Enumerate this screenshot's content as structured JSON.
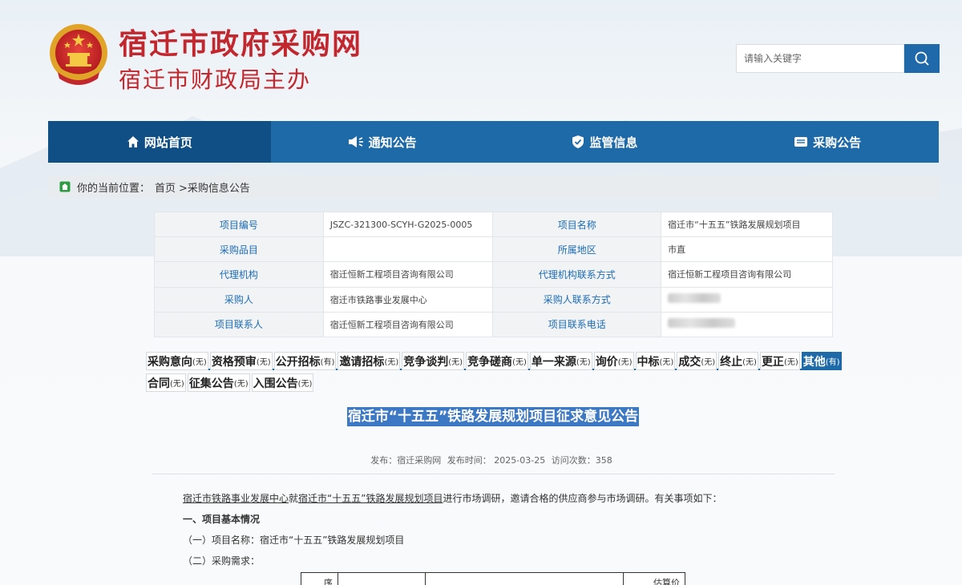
{
  "header": {
    "site_title": "宿迁市政府采购网",
    "site_subtitle": "宿迁市财政局主办",
    "search_placeholder": "请输入关键字"
  },
  "nav": {
    "items": [
      {
        "label": "网站首页",
        "icon": "home-icon"
      },
      {
        "label": "通知公告",
        "icon": "speaker-icon"
      },
      {
        "label": "监管信息",
        "icon": "shield-check-icon"
      },
      {
        "label": "采购公告",
        "icon": "list-icon"
      }
    ]
  },
  "breadcrumb": {
    "prefix": "你的当前位置：",
    "home": "首页",
    "current": ">采购信息公告"
  },
  "info_table": {
    "rows": [
      {
        "l1": "项目编号",
        "v1": "JSZC-321300-SCYH-G2025-0005",
        "l2": "项目名称",
        "v2": "宿迁市“十五五”铁路发展规划项目"
      },
      {
        "l1": "采购品目",
        "v1": "",
        "l2": "所属地区",
        "v2": "市直"
      },
      {
        "l1": "代理机构",
        "v1": "宿迁恒新工程项目咨询有限公司",
        "l2": "代理机构联系方式",
        "v2": "宿迁恒新工程项目咨询有限公司"
      },
      {
        "l1": "采购人",
        "v1": "宿迁市铁路事业发展中心",
        "l2": "采购人联系方式",
        "v2": ""
      },
      {
        "l1": "项目联系人",
        "v1": "宿迁恒新工程项目咨询有限公司",
        "l2": "项目联系电话",
        "v2": ""
      }
    ]
  },
  "tabs": {
    "row1": [
      {
        "label": "采购意向",
        "status": "(无)"
      },
      {
        "label": "资格预审",
        "status": "(无)"
      },
      {
        "label": "公开招标",
        "status": "(有)"
      },
      {
        "label": "邀请招标",
        "status": "(无)"
      },
      {
        "label": "竞争谈判",
        "status": "(无)"
      },
      {
        "label": "竞争磋商",
        "status": "(无)"
      },
      {
        "label": "单一来源",
        "status": "(无)"
      },
      {
        "label": "询价",
        "status": "(无)"
      },
      {
        "label": "中标",
        "status": "(无)"
      },
      {
        "label": "成交",
        "status": "(无)"
      },
      {
        "label": "终止",
        "status": "(无)"
      },
      {
        "label": "更正",
        "status": "(无)"
      },
      {
        "label": "其他",
        "status": "(有)"
      }
    ],
    "row2": [
      {
        "label": "合同",
        "status": "(无)"
      },
      {
        "label": "征集公告",
        "status": "(无)"
      },
      {
        "label": "入围公告",
        "status": "(无)"
      }
    ]
  },
  "article": {
    "title": "宿迁市“十五五”铁路发展规划项目征求意见公告",
    "publisher": "发布：宿迁采购网",
    "publish_time": "发布时间： 2025-03-25",
    "visits": "访问次数：358",
    "intro_org": "宿迁市铁路事业发展中心",
    "intro_mid": "就",
    "intro_proj": "宿迁市“十五五”铁路发展规划项目",
    "intro_rest": "进行市场调研，邀请合格的供应商参与市场调研。有关事项如下：",
    "section1": "一、项目基本情况",
    "item1": "（一）项目名称：宿迁市“十五五”铁路发展规划项目",
    "item2": "（二）采购需求：",
    "table_h1": "序",
    "table_h4": "估算价"
  },
  "colors": {
    "brand_red": "#c1272d",
    "nav_blue": "#1e6aa9",
    "nav_active": "#0f4f86",
    "label_blue": "#1c6cb6",
    "title_highlight": "#3c78c3"
  }
}
